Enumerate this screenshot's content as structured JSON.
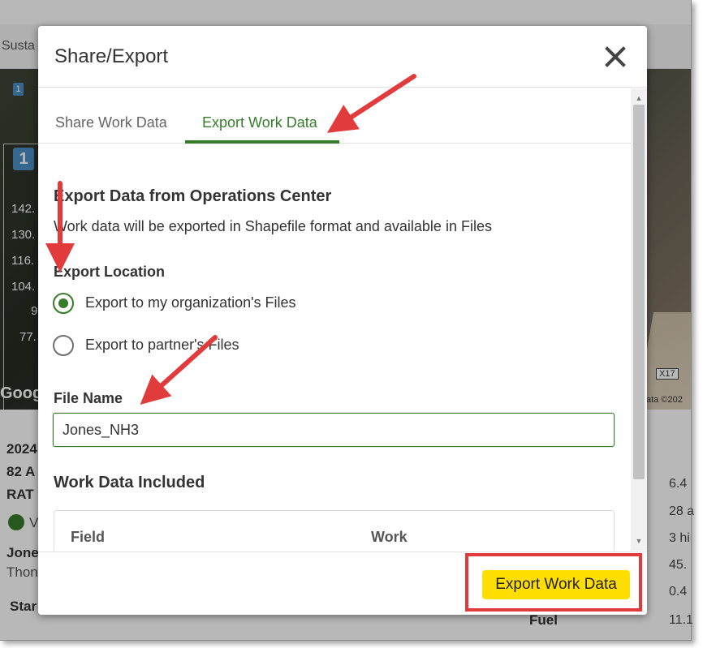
{
  "background": {
    "tab_text": "Susta",
    "small_badge": "1",
    "badge_number": "1",
    "legend_values": [
      "142.",
      "130.",
      "116.",
      "104.",
      "9",
      "77."
    ],
    "map_brand": "Goog",
    "road_marker": "X17",
    "map_credit": "ata ©202",
    "info_left": [
      "2024",
      "82 A",
      "RAT",
      "V",
      "Jone",
      "Thon",
      "Star"
    ],
    "info_right": [
      "6.4",
      "28 a",
      "3 hi",
      "45.",
      "0.4"
    ],
    "fuel_label": "Fuel",
    "fuel_value": "11.1"
  },
  "modal": {
    "title": "Share/Export",
    "close_icon": "close-icon",
    "tabs": [
      {
        "label": "Share Work Data",
        "active": false
      },
      {
        "label": "Export Work Data",
        "active": true
      }
    ],
    "section_title": "Export Data from Operations Center",
    "description": "Work data will be exported in Shapefile format and available in Files",
    "export_location_label": "Export Location",
    "export_options": [
      {
        "label": "Export to my organization's Files",
        "selected": true
      },
      {
        "label": "Export to partner's Files",
        "selected": false
      }
    ],
    "file_name_label": "File Name",
    "file_name_value": "Jones_NH3",
    "work_data_title": "Work Data Included",
    "table_headers": [
      "Field",
      "Work"
    ],
    "export_button": "Export Work Data"
  },
  "colors": {
    "accent_green": "#367c2b",
    "button_yellow": "#ffde00",
    "annotation_red": "#e23b3b"
  }
}
